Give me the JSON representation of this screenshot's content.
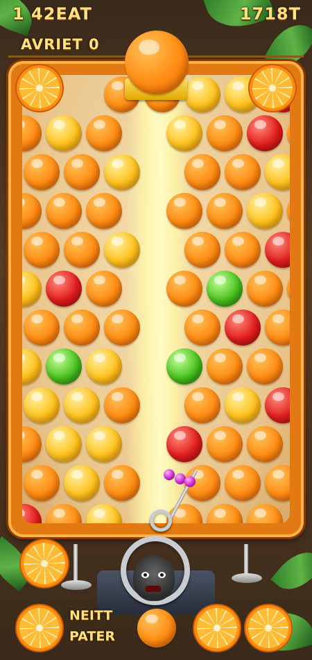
{
  "hud": {
    "top_left": "1 42EAT",
    "top_right": "1718T",
    "sub_left": "AVRIET 0"
  },
  "bottom_button": {
    "line1": "NEITT",
    "line2": "PATER"
  },
  "colors": {
    "orange": "#ff8c12",
    "yellow": "#ffc21d",
    "red": "#e21d1d",
    "green": "#49c21d",
    "frame": "#e37912",
    "text": "#ffe07a"
  },
  "board": {
    "rows": [
      "--ooyyrooy",
      "oyo.yoro.",
      "ooy.ooyyo",
      "ooo.ooyoy",
      "ooy.oorrr",
      "yro.ogoo.",
      "ooo.oroo.",
      "ygy.goo.",
      "yyo.oyr.",
      "oyy.roo.",
      "oyo.ooo.",
      "roy.ooo."
    ]
  },
  "shooter": {
    "current_ball": "orange",
    "next_ball": "orange"
  }
}
